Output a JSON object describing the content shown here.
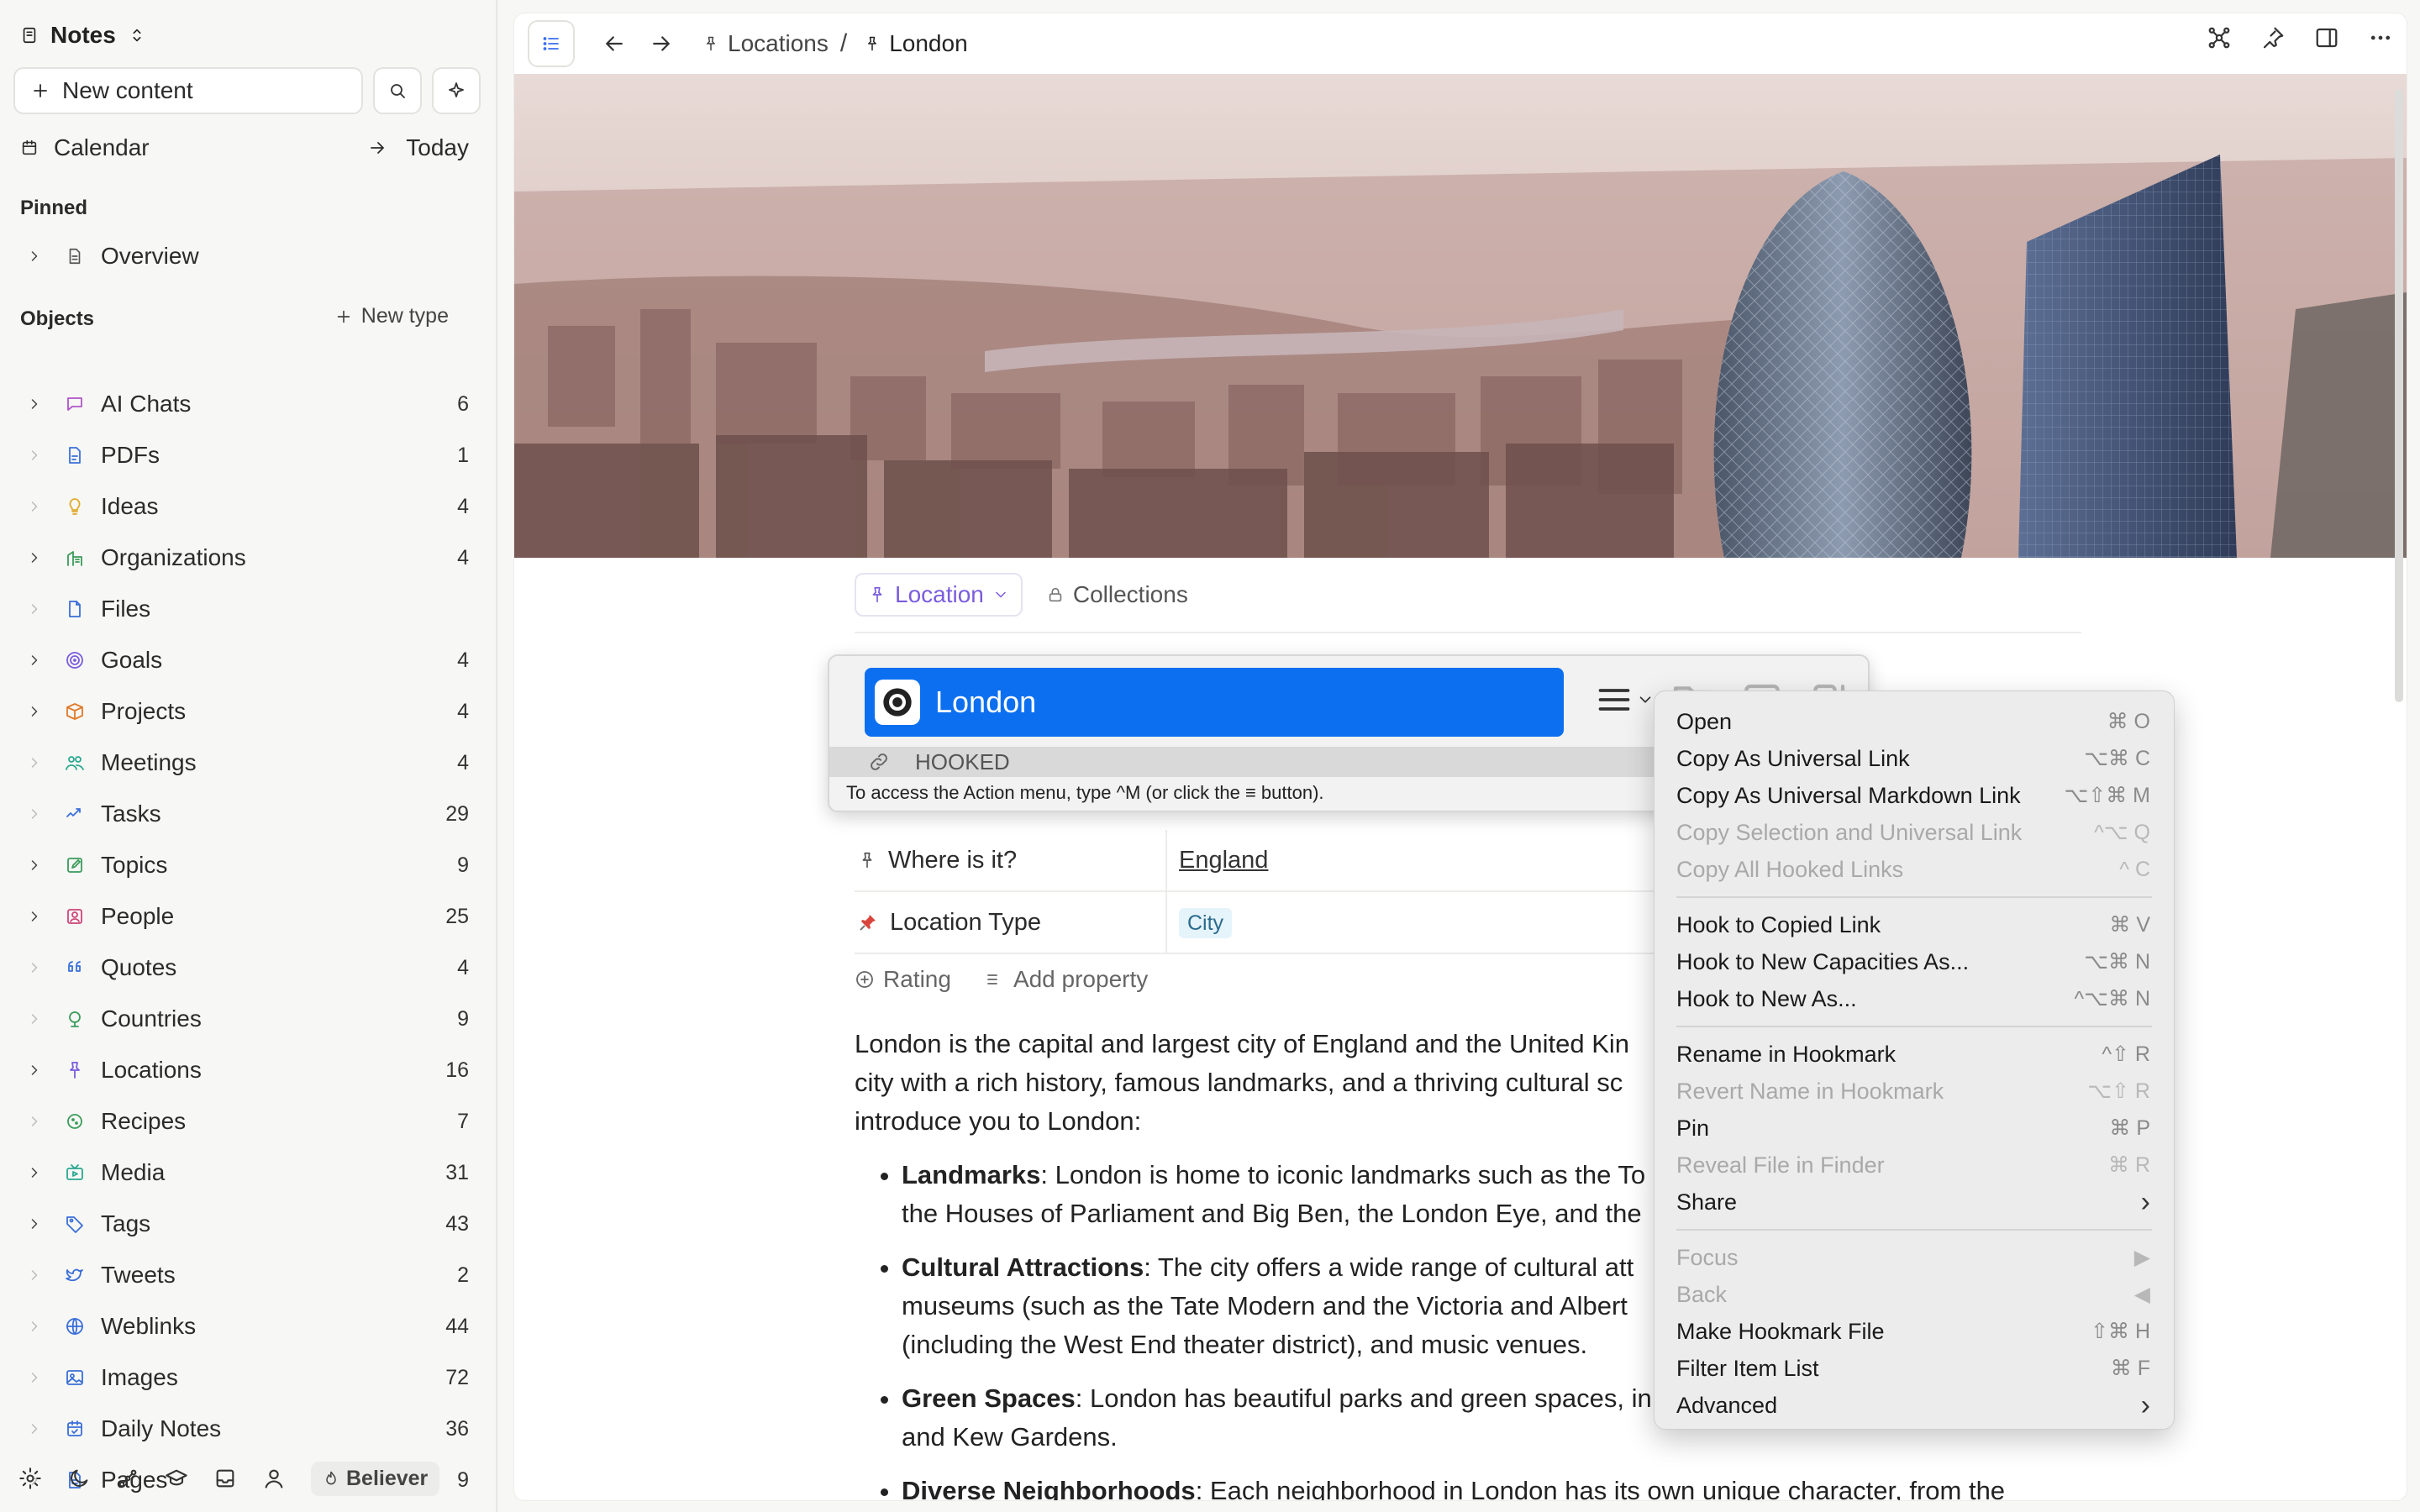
{
  "sidebar": {
    "space_name": "Notes",
    "new_content_label": "New content",
    "calendar_label": "Calendar",
    "today_label": "Today",
    "pinned_title": "Pinned",
    "pinned_items": [
      {
        "label": "Overview"
      }
    ],
    "objects_title": "Objects",
    "new_type_label": "New type",
    "items": [
      {
        "label": "AI Chats",
        "count": "6",
        "icon": "chat-icon",
        "color": "#b055c9"
      },
      {
        "label": "PDFs",
        "count": "1",
        "icon": "pdf-icon",
        "color": "#3a6fd8"
      },
      {
        "label": "Ideas",
        "count": "4",
        "icon": "lightbulb-icon",
        "color": "#e0a92a"
      },
      {
        "label": "Organizations",
        "count": "4",
        "icon": "building-icon",
        "color": "#3a9b5a"
      },
      {
        "label": "Files",
        "count": "",
        "icon": "file-icon",
        "color": "#3a6fd8"
      },
      {
        "label": "Goals",
        "count": "4",
        "icon": "target-icon",
        "color": "#7a5cdc"
      },
      {
        "label": "Projects",
        "count": "4",
        "icon": "box-icon",
        "color": "#e07a2a"
      },
      {
        "label": "Meetings",
        "count": "4",
        "icon": "people-icon",
        "color": "#2aa890"
      },
      {
        "label": "Tasks",
        "count": "29",
        "icon": "check-icon",
        "color": "#3a6fd8"
      },
      {
        "label": "Topics",
        "count": "9",
        "icon": "edit-icon",
        "color": "#3a9b5a"
      },
      {
        "label": "People",
        "count": "25",
        "icon": "person-icon",
        "color": "#d0457a"
      },
      {
        "label": "Quotes",
        "count": "4",
        "icon": "quote-icon",
        "color": "#3a6fd8"
      },
      {
        "label": "Countries",
        "count": "9",
        "icon": "globe-icon",
        "color": "#3a9b5a"
      },
      {
        "label": "Locations",
        "count": "16",
        "icon": "pin-icon",
        "color": "#7a5cdc"
      },
      {
        "label": "Recipes",
        "count": "7",
        "icon": "recipe-icon",
        "color": "#3a9b5a"
      },
      {
        "label": "Media",
        "count": "31",
        "icon": "media-icon",
        "color": "#2aa890"
      },
      {
        "label": "Tags",
        "count": "43",
        "icon": "tag-icon",
        "color": "#3a6fd8"
      },
      {
        "label": "Tweets",
        "count": "2",
        "icon": "bird-icon",
        "color": "#3a6fd8"
      },
      {
        "label": "Weblinks",
        "count": "44",
        "icon": "link-icon",
        "color": "#3a6fd8"
      },
      {
        "label": "Images",
        "count": "72",
        "icon": "image-icon",
        "color": "#3a6fd8"
      },
      {
        "label": "Daily Notes",
        "count": "36",
        "icon": "calendar-icon",
        "color": "#3a6fd8"
      },
      {
        "label": "Pages",
        "count": "9",
        "icon": "page-icon",
        "color": "#3a6fd8"
      }
    ],
    "footer_badge": "Believer"
  },
  "topbar": {
    "crumbs": [
      "Locations",
      "London"
    ],
    "separator": "/"
  },
  "page": {
    "type_label": "Location",
    "collections_label": "Collections",
    "properties": [
      {
        "name": "Where is it?",
        "value": "England",
        "icon": "pin-icon"
      },
      {
        "name": "Location Type",
        "value": "City",
        "icon": "pushpin-icon"
      }
    ],
    "rating_label": "Rating",
    "add_property_label": "Add property",
    "intro": "London is the capital and largest city of England and the United Kin",
    "intro_2": "city with a rich history, famous landmarks, and a thriving cultural sc",
    "intro_3": "introduce you to London:",
    "bullets": [
      {
        "title": "Landmarks",
        "l1": ": London is home to iconic landmarks such as the To",
        "l2": "the Houses of Parliament and Big Ben, the London Eye, and the",
        "l3": ""
      },
      {
        "title": "Cultural Attractions",
        "l1": ": The city offers a wide range of cultural att",
        "l2": "museums (such as the Tate Modern and the Victoria and Albert",
        "l3": "(including the West End theater district), and music venues."
      },
      {
        "title": "Green Spaces",
        "l1": ": London has beautiful parks and green spaces, in",
        "l2": "and Kew Gardens.",
        "l3": ""
      },
      {
        "title": "Diverse Neighborhoods",
        "l1": ": Each neighborhood in London has its own unique character, from the",
        "l2": "",
        "l3": ""
      }
    ]
  },
  "hook": {
    "title": "London",
    "status": "HOOKED",
    "help": "To access the Action menu, type ^M (or click the ≡ button)."
  },
  "context_menu": {
    "groups": [
      [
        {
          "label": "Open",
          "shortcut": "⌘ O",
          "enabled": true
        },
        {
          "label": "Copy As Universal Link",
          "shortcut": "⌥⌘ C",
          "enabled": true
        },
        {
          "label": "Copy As Universal Markdown Link",
          "shortcut": "⌥⇧⌘ M",
          "enabled": true
        },
        {
          "label": "Copy Selection and Universal Link",
          "shortcut": "^⌥ Q",
          "enabled": false
        },
        {
          "label": "Copy All Hooked Links",
          "shortcut": "^ C",
          "enabled": false
        }
      ],
      [
        {
          "label": "Hook to Copied Link",
          "shortcut": "⌘ V",
          "enabled": true
        },
        {
          "label": "Hook to New Capacities As...",
          "shortcut": "⌥⌘ N",
          "enabled": true
        },
        {
          "label": "Hook to New As...",
          "shortcut": "^⌥⌘ N",
          "enabled": true
        }
      ],
      [
        {
          "label": "Rename in Hookmark",
          "shortcut": "^⇧ R",
          "enabled": true
        },
        {
          "label": "Revert Name in Hookmark",
          "shortcut": "⌥⇧ R",
          "enabled": false
        },
        {
          "label": "Pin",
          "shortcut": "⌘ P",
          "enabled": true
        },
        {
          "label": "Reveal File in Finder",
          "shortcut": "⌘ R",
          "enabled": false
        },
        {
          "label": "Share",
          "shortcut": "›",
          "enabled": true
        }
      ],
      [
        {
          "label": "Focus",
          "shortcut": "▶",
          "enabled": false
        },
        {
          "label": "Back",
          "shortcut": "◀",
          "enabled": false
        },
        {
          "label": "Make Hookmark File",
          "shortcut": "⇧⌘ H",
          "enabled": true
        },
        {
          "label": "Filter Item List",
          "shortcut": "⌘ F",
          "enabled": true
        },
        {
          "label": "Advanced",
          "shortcut": "›",
          "enabled": true
        }
      ]
    ]
  }
}
